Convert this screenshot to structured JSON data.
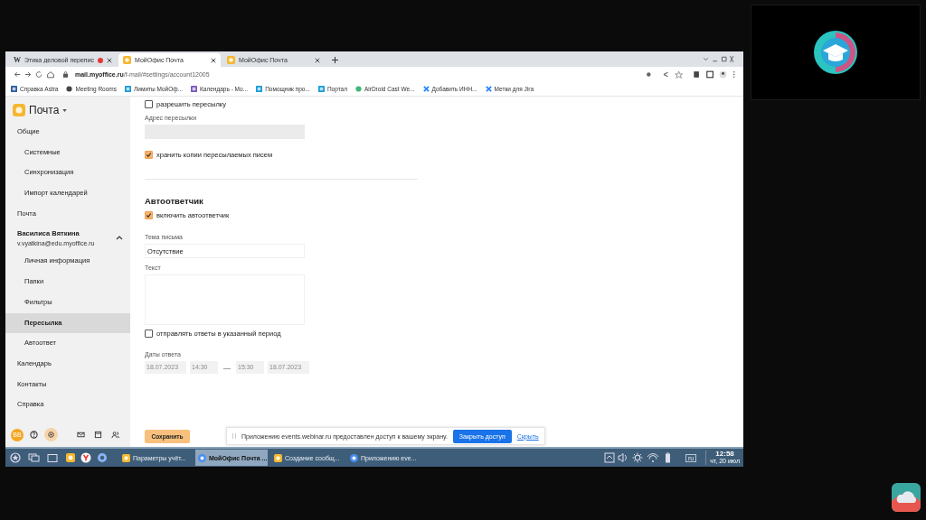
{
  "browser": {
    "tabs": [
      {
        "title": "Этика деловой перепис",
        "kind": "wiki",
        "icon_text": "W",
        "recording": true,
        "selected": false
      },
      {
        "title": "МойОфис Почта",
        "kind": "mail",
        "recording": false,
        "selected": true
      },
      {
        "title": "МойОфис Почта",
        "kind": "mail",
        "recording": false,
        "selected": false
      }
    ],
    "address": "**mail.myoffice.ru**/f-mail/#settings/account12005",
    "bookmarks": [
      {
        "label": "Справка Astra",
        "kind": "doc"
      },
      {
        "label": "Meeting Rooms",
        "kind": "globe"
      },
      {
        "label": "Лимиты МойОф...",
        "kind": "app"
      },
      {
        "label": "Календарь - Мо...",
        "kind": "calendar"
      },
      {
        "label": "Помощник про...",
        "kind": "app"
      },
      {
        "label": "Портал",
        "kind": "app"
      },
      {
        "label": "AirDroid Cast We...",
        "kind": "android"
      },
      {
        "label": "Добавить ИНН...",
        "kind": "jira"
      },
      {
        "label": "Метки для Jira",
        "kind": "jira"
      }
    ]
  },
  "app": {
    "logo": "Почта",
    "sidebar": {
      "items": [
        {
          "label": "Общие",
          "selected": false,
          "children": [
            {
              "label": "Системные",
              "selected": false
            },
            {
              "label": "Синхронизация",
              "selected": false
            },
            {
              "label": "Импорт календарей",
              "selected": false
            }
          ]
        },
        {
          "label": "Почта",
          "selected": false
        },
        {
          "kind": "account",
          "label": "Василиса Вяткина",
          "email": "v.vyatkina@edu.myoffice.ru",
          "expanded": true,
          "selected": false,
          "children": [
            {
              "label": "Личная информация",
              "selected": false
            },
            {
              "label": "Папки",
              "selected": false
            },
            {
              "label": "Фильтры",
              "selected": false
            },
            {
              "label": "Пересылка",
              "selected": true
            },
            {
              "label": "Автоответ",
              "selected": false
            }
          ]
        },
        {
          "label": "Календарь",
          "selected": false
        },
        {
          "label": "Контакты",
          "selected": false
        },
        {
          "label": "Справка",
          "selected": false
        }
      ],
      "footer": {
        "avatar": "ВВ",
        "buttons": [
          {
            "kind": "help",
            "selected": false
          },
          {
            "kind": "settings",
            "selected": true
          },
          {
            "kind": "mail",
            "selected": false
          },
          {
            "kind": "calendar",
            "selected": false
          },
          {
            "kind": "contacts",
            "selected": false
          }
        ]
      }
    },
    "forwarding": {
      "allow": {
        "label": "разрешить пересылку",
        "checked": false
      },
      "address_label": "Адрес пересылки",
      "keep_copies": {
        "label": "хранить копии пересылаемых писем",
        "checked": true
      }
    },
    "autoreply": {
      "heading": "Автоответчик",
      "enable": {
        "label": "включить автоответчик",
        "checked": true
      },
      "subject_label": "Тема письма",
      "subject": "Отсутствие",
      "text_label": "Текст",
      "period": {
        "label": "отправлять ответы в указанный период",
        "checked": false
      },
      "dates_label": "Даты ответа",
      "start_date": "18.07.2023",
      "start_time": "14:30",
      "separator": "—",
      "end_time": "15:30",
      "end_date": "18.07.2023"
    },
    "save": "Сохранить",
    "share_banner": {
      "text": "Приложению events.webinar.ru предоставлен доступ к вашему экрану.",
      "stop": "Закрыть доступ",
      "hide": "Скрыть"
    }
  },
  "taskbar": {
    "windows": [
      {
        "title": "Параметры учёт...",
        "kind": "mail",
        "selected": false
      },
      {
        "title": "МойОфис Почта ...",
        "kind": "chrome",
        "selected": true
      },
      {
        "title": "Создание сообщ...",
        "kind": "mail",
        "selected": false
      },
      {
        "title": "Приложению eve...",
        "kind": "chrome",
        "selected": false
      }
    ],
    "language": "ru",
    "time": "12:58",
    "date": "чт, 20 июл"
  }
}
